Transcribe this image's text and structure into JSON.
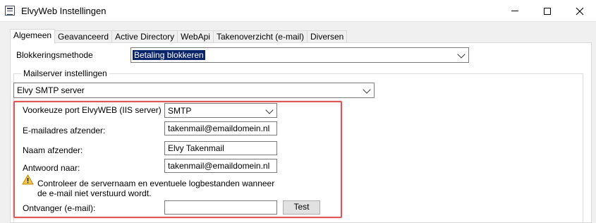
{
  "window": {
    "title": "ElvyWeb Instellingen",
    "min_icon": "minimize-icon",
    "max_icon": "maximize-icon",
    "close_icon": "close-icon"
  },
  "tabs": [
    {
      "label": "Algemeen",
      "active": true
    },
    {
      "label": "Geavanceerd",
      "active": false
    },
    {
      "label": "Active Directory",
      "active": false
    },
    {
      "label": "WebApi",
      "active": false
    },
    {
      "label": "Takenoverzicht (e-mail)",
      "active": false
    },
    {
      "label": "Diversen",
      "active": false
    }
  ],
  "general": {
    "blocking_label": "Blokkeringsmethode",
    "blocking_value": "Betaling blokkeren"
  },
  "mailserver": {
    "group_title": "Mailserver instellingen",
    "server_value": "Elvy SMTP server",
    "port_label": "Voorkeuze port  ElvyWEB (IIS server)",
    "port_value": "SMTP",
    "sender_email_label": "E-mailadres afzender:",
    "sender_email_value": "takenmail@emaildomein.nl",
    "sender_name_label": "Naam afzender:",
    "sender_name_value": "Elvy Takenmail",
    "reply_to_label": "Antwoord naar:",
    "reply_to_value": "takenmail@emaildomein.nl",
    "warning_line1": "Controleer de servernaam en eventuele logbestanden wanneer",
    "warning_line2": "de e-mail niet verstuurd wordt.",
    "recipient_label": "Ontvanger (e-mail):",
    "recipient_value": "",
    "test_button": "Test"
  },
  "colors": {
    "highlight_border": "#e05555",
    "selection_bg": "#0a246a",
    "warning_icon": "#f2c94c"
  }
}
